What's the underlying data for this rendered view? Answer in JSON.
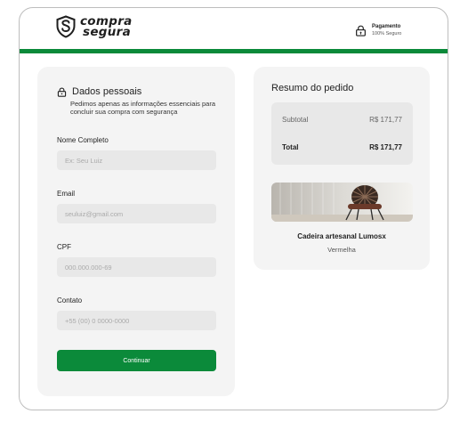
{
  "header": {
    "logo": {
      "line1": "compra",
      "line2": "segura"
    },
    "payment": {
      "title": "Pagamento",
      "subtitle": "100% Seguro"
    }
  },
  "form": {
    "title": "Dados pessoais",
    "description": "Pedimos apenas as informações essenciais para concluir sua compra com segurança",
    "fields": [
      {
        "label": "Nome Completo",
        "placeholder": "Ex: Seu Luiz"
      },
      {
        "label": "Email",
        "placeholder": "seuluiz@gmail.com"
      },
      {
        "label": "CPF",
        "placeholder": "000.000.000-69"
      },
      {
        "label": "Contato",
        "placeholder": "+55 (00) 0 0000-0000"
      }
    ],
    "submit_label": "Continuar"
  },
  "summary": {
    "title": "Resumo do pedido",
    "subtotal_label": "Subtotal",
    "subtotal_value": "R$ 171,77",
    "total_label": "Total",
    "total_value": "R$ 171,77",
    "product": {
      "name": "Cadeira artesanal Lumosx",
      "variant": "Vermelha"
    }
  },
  "colors": {
    "brand_green": "#0b8a3a",
    "card_bg": "#f4f4f4",
    "input_bg": "#e8e8e8"
  },
  "icons": {
    "logo": "shield-s-logo-icon",
    "payment": "padlock-icon",
    "section": "padlock-icon"
  }
}
